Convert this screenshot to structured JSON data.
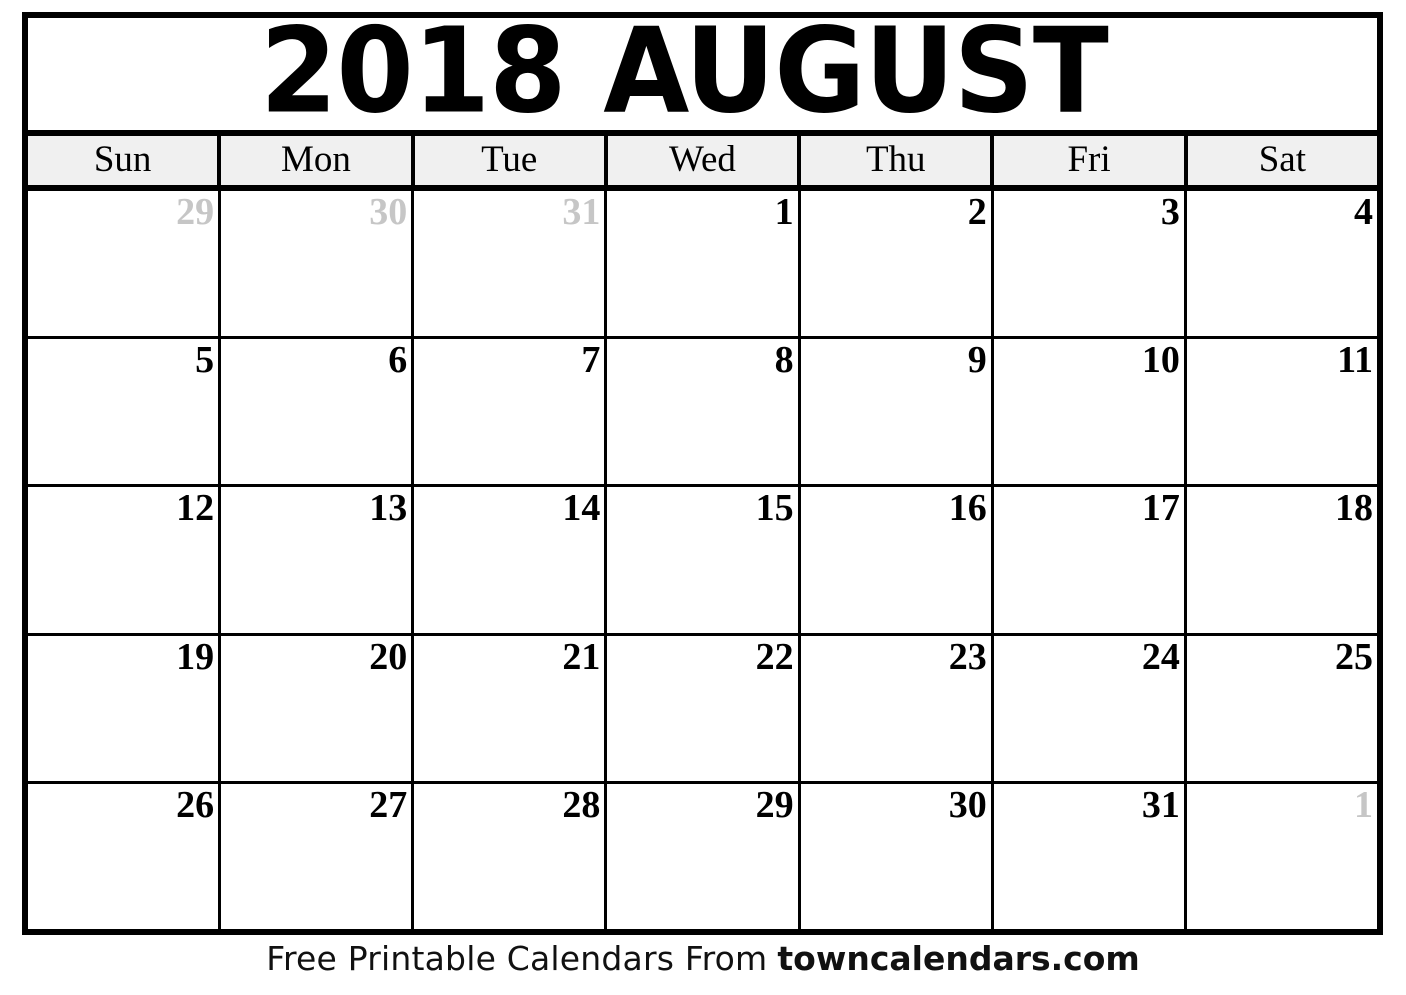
{
  "calendar": {
    "title": "2018 AUGUST",
    "year": "2018",
    "month_name": "AUGUST",
    "weekday_headers": [
      {
        "label": "Sun"
      },
      {
        "label": "Mon"
      },
      {
        "label": "Tue"
      },
      {
        "label": "Wed"
      },
      {
        "label": "Thu"
      },
      {
        "label": "Fri"
      },
      {
        "label": "Sat"
      }
    ],
    "weeks": [
      {
        "days": [
          {
            "number": "29",
            "in_month": false
          },
          {
            "number": "30",
            "in_month": false
          },
          {
            "number": "31",
            "in_month": false
          },
          {
            "number": "1",
            "in_month": true
          },
          {
            "number": "2",
            "in_month": true
          },
          {
            "number": "3",
            "in_month": true
          },
          {
            "number": "4",
            "in_month": true
          }
        ]
      },
      {
        "days": [
          {
            "number": "5",
            "in_month": true
          },
          {
            "number": "6",
            "in_month": true
          },
          {
            "number": "7",
            "in_month": true
          },
          {
            "number": "8",
            "in_month": true
          },
          {
            "number": "9",
            "in_month": true
          },
          {
            "number": "10",
            "in_month": true
          },
          {
            "number": "11",
            "in_month": true
          }
        ]
      },
      {
        "days": [
          {
            "number": "12",
            "in_month": true
          },
          {
            "number": "13",
            "in_month": true
          },
          {
            "number": "14",
            "in_month": true
          },
          {
            "number": "15",
            "in_month": true
          },
          {
            "number": "16",
            "in_month": true
          },
          {
            "number": "17",
            "in_month": true
          },
          {
            "number": "18",
            "in_month": true
          }
        ]
      },
      {
        "days": [
          {
            "number": "19",
            "in_month": true
          },
          {
            "number": "20",
            "in_month": true
          },
          {
            "number": "21",
            "in_month": true
          },
          {
            "number": "22",
            "in_month": true
          },
          {
            "number": "23",
            "in_month": true
          },
          {
            "number": "24",
            "in_month": true
          },
          {
            "number": "25",
            "in_month": true
          }
        ]
      },
      {
        "days": [
          {
            "number": "26",
            "in_month": true
          },
          {
            "number": "27",
            "in_month": true
          },
          {
            "number": "28",
            "in_month": true
          },
          {
            "number": "29",
            "in_month": true
          },
          {
            "number": "30",
            "in_month": true
          },
          {
            "number": "31",
            "in_month": true
          },
          {
            "number": "1",
            "in_month": false
          }
        ]
      }
    ]
  },
  "footer": {
    "text": "Free Printable Calendars From",
    "site": "towncalendars.com"
  },
  "colors": {
    "border": "#000000",
    "header_band": "#f0f0f0",
    "day_number": "#000000",
    "out_of_month_number": "#c6c6c6",
    "page_background": "#ffffff"
  }
}
